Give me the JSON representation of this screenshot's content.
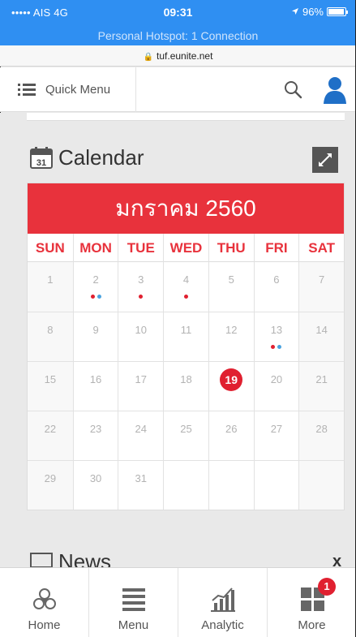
{
  "status_bar": {
    "carrier": "••••• AIS  4G",
    "time": "09:31",
    "battery": "96%",
    "battery_level": 0.96,
    "hotspot": "Personal Hotspot: 1 Connection",
    "bg_color": "#2f8ff2"
  },
  "browser": {
    "url": "tuf.eunite.net",
    "lock_icon": "lock-icon"
  },
  "topbar": {
    "quick_menu_label": "Quick Menu",
    "icons": [
      "list-menu-icon",
      "search-icon",
      "user-avatar-icon"
    ]
  },
  "calendar": {
    "title": "Calendar",
    "calendar_icon_text": "31",
    "month_title": "มกราคม 2560",
    "accent_color": "#e8323c",
    "weekdays": [
      "SUN",
      "MON",
      "TUE",
      "WED",
      "THU",
      "FRI",
      "SAT"
    ],
    "weeks": [
      [
        "1",
        "2",
        "3",
        "4",
        "5",
        "6",
        "7"
      ],
      [
        "8",
        "9",
        "10",
        "11",
        "12",
        "13",
        "14"
      ],
      [
        "15",
        "16",
        "17",
        "18",
        "19",
        "20",
        "21"
      ],
      [
        "22",
        "23",
        "24",
        "25",
        "26",
        "27",
        "28"
      ],
      [
        "29",
        "30",
        "31",
        "",
        "",
        "",
        ""
      ]
    ],
    "today": "19",
    "event_dots": {
      "2": [
        "#e02030",
        "#4aa3df"
      ],
      "3": [
        "#e02030"
      ],
      "4": [
        "#e02030"
      ],
      "13": [
        "#e02030",
        "#4aa3df"
      ]
    }
  },
  "news": {
    "title": "News",
    "close_label": "x"
  },
  "tabbar": {
    "tabs": [
      {
        "label": "Home",
        "icon": "home-triskelion-icon"
      },
      {
        "label": "Menu",
        "icon": "menu-lines-icon"
      },
      {
        "label": "Analytic",
        "icon": "analytics-chart-icon"
      },
      {
        "label": "More",
        "icon": "more-grid-icon",
        "badge": "1"
      }
    ]
  }
}
